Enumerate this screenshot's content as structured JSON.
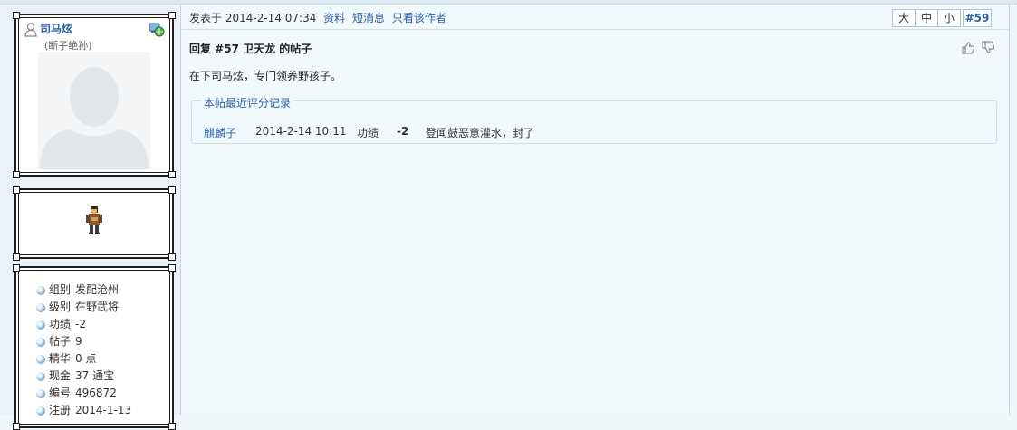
{
  "user": {
    "name": "司马炫",
    "title": "(断子绝孙)",
    "stats": [
      {
        "label": "组别",
        "value": "发配沧州"
      },
      {
        "label": "级别",
        "value": "在野武将"
      },
      {
        "label": "功绩",
        "value": "-2"
      },
      {
        "label": "帖子",
        "value": "9"
      },
      {
        "label": "精华",
        "value": "0 点"
      },
      {
        "label": "现金",
        "value": "37 通宝"
      },
      {
        "label": "编号",
        "value": "496872"
      },
      {
        "label": "注册",
        "value": "2014-1-13"
      }
    ]
  },
  "post": {
    "posted_prefix": "发表于",
    "posted_time": "2014-2-14 07:34",
    "links": {
      "profile": "资料",
      "pm": "短消息",
      "only_author": "只看该作者"
    },
    "font_sizes": {
      "large": "大",
      "medium": "中",
      "small": "小"
    },
    "floor": "#59",
    "title": "回复 #57 卫天龙 的帖子",
    "body": "在下司马炫，专门领养野孩子。"
  },
  "rating": {
    "legend": "本帖最近评分记录",
    "records": [
      {
        "user": "麒麟子",
        "date": "2014-2-14 10:11",
        "field": "功绩",
        "score": "-2",
        "reason": "登闻鼓恶意灌水，封了"
      }
    ]
  }
}
